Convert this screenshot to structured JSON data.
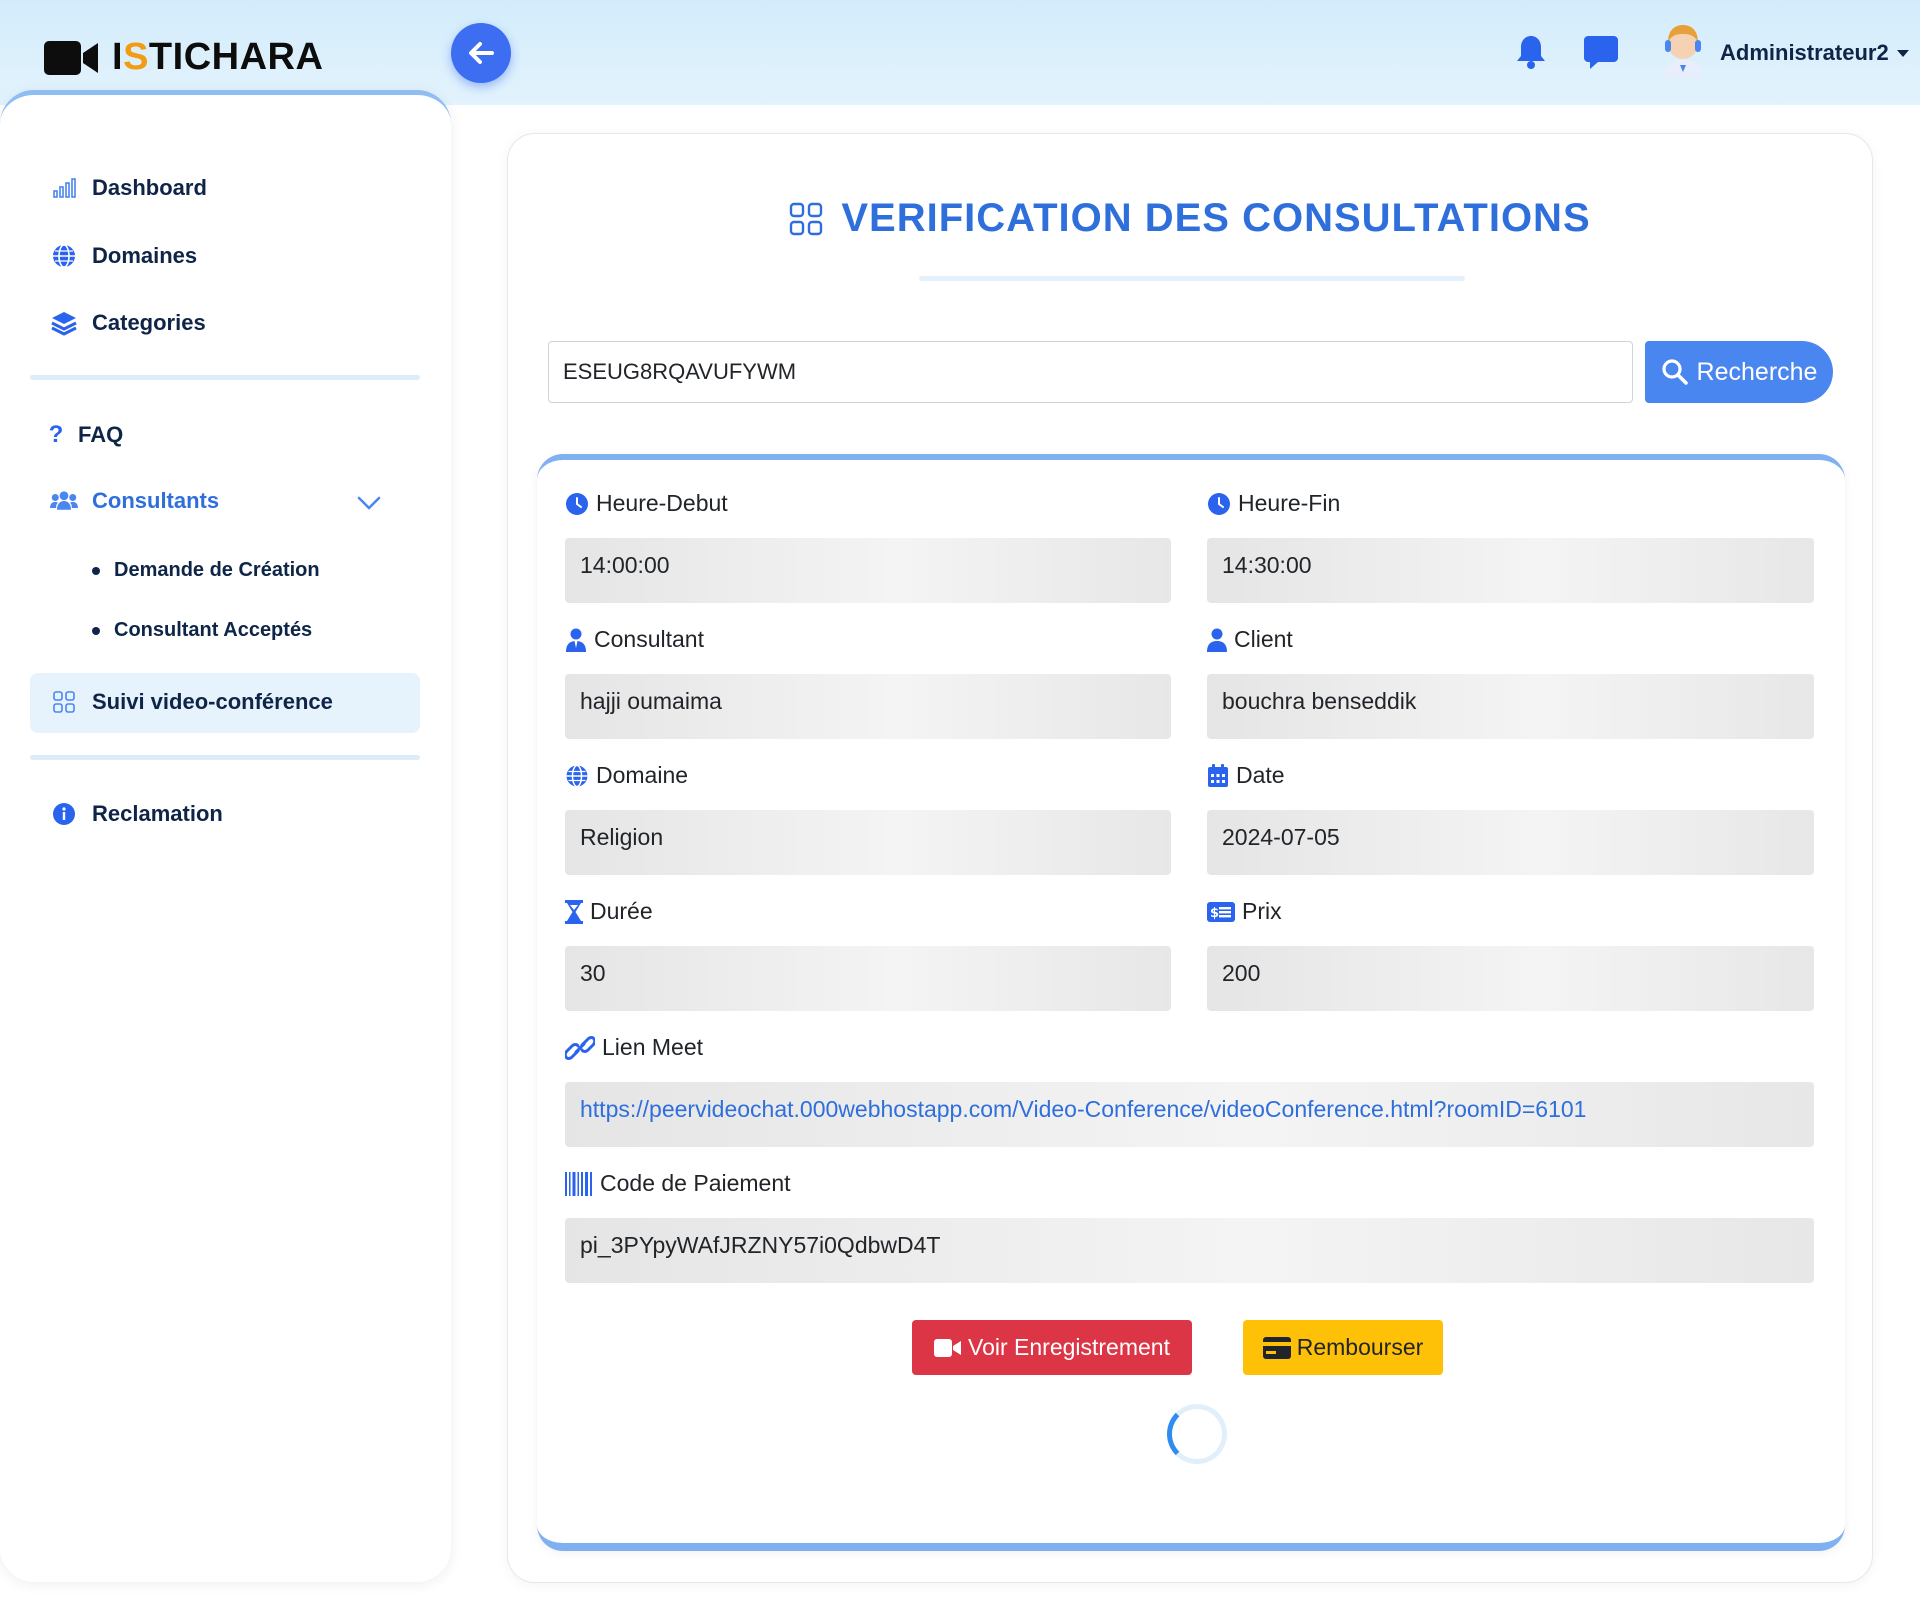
{
  "header": {
    "logo_prefix": "I",
    "logo_accent": "S",
    "logo_rest": "TICHARA",
    "user_name": "Administrateur2",
    "icons": [
      "video-camera-icon",
      "arrow-left-icon",
      "bell-icon",
      "chat-icon",
      "avatar"
    ]
  },
  "sidebar": {
    "items": [
      {
        "label": "Dashboard",
        "icon": "bar-chart-icon"
      },
      {
        "label": "Domaines",
        "icon": "globe-icon"
      },
      {
        "label": "Categories",
        "icon": "layers-icon"
      },
      {
        "label": "FAQ",
        "icon": "question-icon"
      },
      {
        "label": "Consultants",
        "icon": "users-icon"
      },
      {
        "label": "Suivi video-conférence",
        "icon": "grid-icon"
      },
      {
        "label": "Reclamation",
        "icon": "info-icon"
      }
    ],
    "consultants_subitems": [
      "Demande de Création",
      "Consultant Acceptés"
    ],
    "active_item": "Suivi video-conférence"
  },
  "main": {
    "title": "VERIFICATION DES CONSULTATIONS",
    "search": {
      "value": "ESEUG8RQAVUFYWM",
      "button_label": "Recherche"
    },
    "fields": {
      "heure_debut": {
        "label": "Heure-Debut",
        "value": "14:00:00"
      },
      "heure_fin": {
        "label": "Heure-Fin",
        "value": "14:30:00"
      },
      "consultant": {
        "label": "Consultant",
        "value": "hajji oumaima"
      },
      "client": {
        "label": "Client",
        "value": "bouchra benseddik"
      },
      "domaine": {
        "label": "Domaine",
        "value": "Religion"
      },
      "date": {
        "label": "Date",
        "value": "2024-07-05"
      },
      "duree": {
        "label": "Durée",
        "value": "30"
      },
      "prix": {
        "label": "Prix",
        "value": "200"
      },
      "lien_meet": {
        "label": "Lien Meet",
        "value": "https://peervideochat.000webhostapp.com/Video-Conference/videoConference.html?roomID=6101"
      },
      "code_paiement": {
        "label": "Code de Paiement",
        "value": "pi_3PYpyWAfJRZNY57i0QdbwD4T"
      }
    },
    "buttons": {
      "voir": "Voir Enregistrement",
      "rembourser": "Rembourser"
    }
  },
  "colors": {
    "accent": "#2f6fdb",
    "primary_button": "#4a86f0",
    "danger": "#dc3545",
    "warning": "#ffc107",
    "navy": "#0f2548"
  }
}
